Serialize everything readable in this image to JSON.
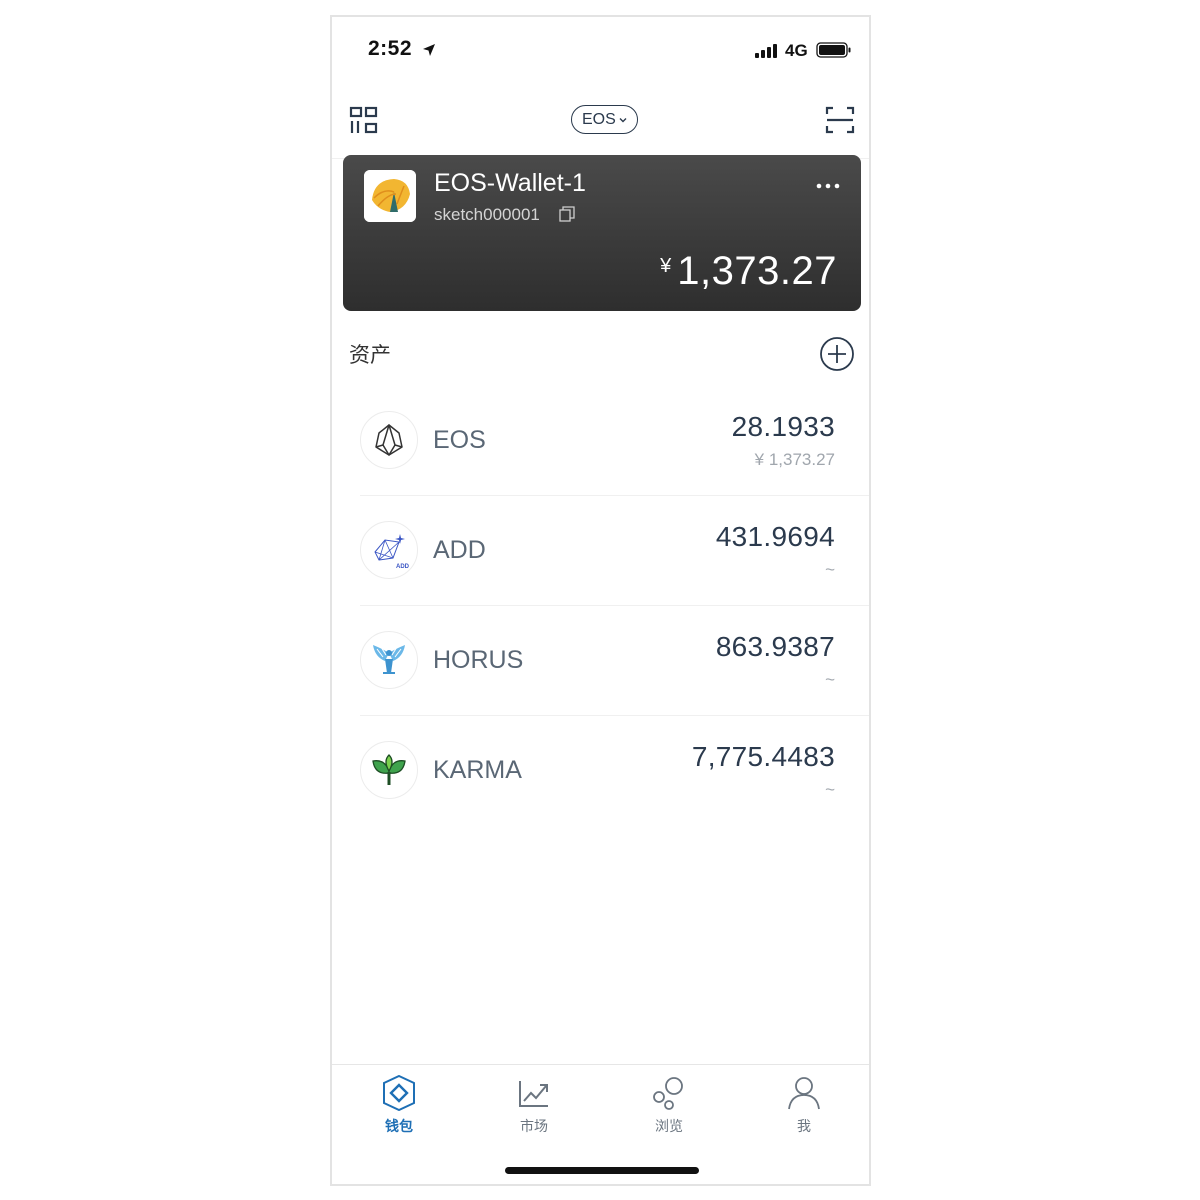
{
  "status_bar": {
    "time": "2:52",
    "network": "4G"
  },
  "nav": {
    "chain_label": "EOS"
  },
  "wallet": {
    "name": "EOS-Wallet-1",
    "account": "sketch000001",
    "currency_symbol": "¥",
    "balance": "1,373.27"
  },
  "assets": {
    "title": "资产",
    "items": [
      {
        "symbol": "EOS",
        "amount": "28.1933",
        "value": "¥ 1,373.27",
        "icon": "eos-logo-icon"
      },
      {
        "symbol": "ADD",
        "amount": "431.9694",
        "value": "~",
        "icon": "add-logo-icon"
      },
      {
        "symbol": "HORUS",
        "amount": "863.9387",
        "value": "~",
        "icon": "horus-logo-icon"
      },
      {
        "symbol": "KARMA",
        "amount": "7,775.4483",
        "value": "~",
        "icon": "karma-logo-icon"
      }
    ]
  },
  "tabs": [
    {
      "label": "钱包",
      "icon": "wallet-tab-icon",
      "active": true
    },
    {
      "label": "市场",
      "icon": "market-tab-icon",
      "active": false
    },
    {
      "label": "浏览",
      "icon": "browse-tab-icon",
      "active": false
    },
    {
      "label": "我",
      "icon": "profile-tab-icon",
      "active": false
    }
  ],
  "colors": {
    "accent": "#1e6fb5",
    "text_dark": "#2b3a4d",
    "card_dark": "#2e2e2e"
  }
}
